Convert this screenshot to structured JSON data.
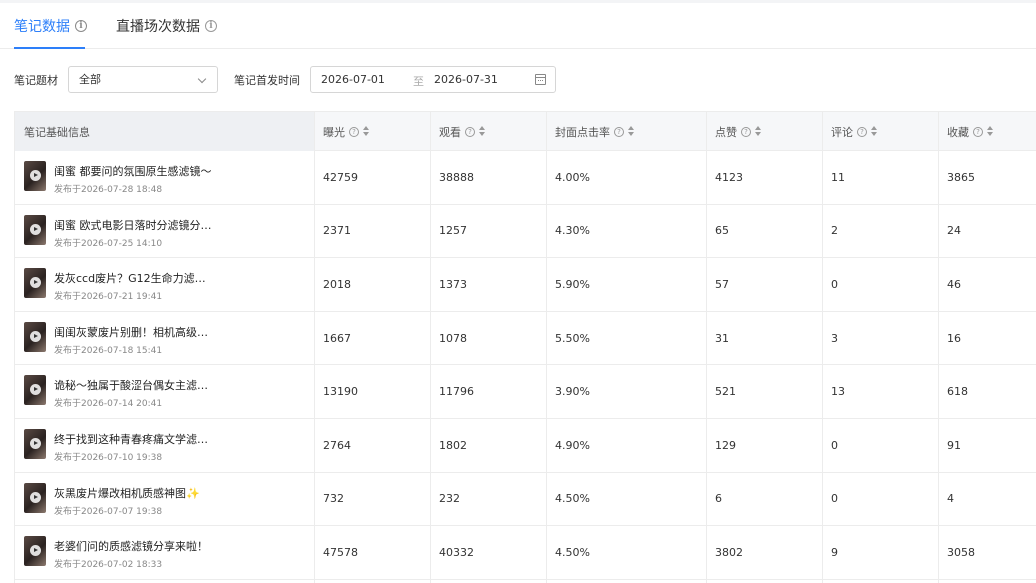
{
  "tabs": [
    {
      "label": "笔记数据",
      "active": true
    },
    {
      "label": "直播场次数据",
      "active": false
    }
  ],
  "colors": {
    "accent": "#2d7ff9",
    "header_bg": "#f6f7f9",
    "border": "#ececec"
  },
  "filters": {
    "topic_label": "笔记题材",
    "topic_value": "全部",
    "date_label": "笔记首发时间",
    "date_start": "2026-07-01",
    "date_sep": "至",
    "date_end": "2026-07-31"
  },
  "table": {
    "columns": [
      "笔记基础信息",
      "曝光",
      "观看",
      "封面点击率",
      "点赞",
      "评论",
      "收藏"
    ],
    "rows": [
      {
        "title": "闺蜜 都要问的氛围原生感滤镜～",
        "date": "发布于2026-07-28 18:48",
        "cells": [
          "42759",
          "38888",
          "4.00%",
          "4123",
          "11",
          "3865"
        ]
      },
      {
        "title": "闺蜜 欧式电影日落时分滤镜分…",
        "date": "发布于2026-07-25 14:10",
        "cells": [
          "2371",
          "1257",
          "4.30%",
          "65",
          "2",
          "24"
        ]
      },
      {
        "title": "发灰ccd废片？G12生命力滤…",
        "date": "发布于2026-07-21 19:41",
        "cells": [
          "2018",
          "1373",
          "5.90%",
          "57",
          "0",
          "46"
        ]
      },
      {
        "title": "闺闺灰蒙废片别删！相机高级…",
        "date": "发布于2026-07-18 15:41",
        "cells": [
          "1667",
          "1078",
          "5.50%",
          "31",
          "3",
          "16"
        ]
      },
      {
        "title": "诡秘～独属于酸涩台偶女主滤…",
        "date": "发布于2026-07-14 20:41",
        "cells": [
          "13190",
          "11796",
          "3.90%",
          "521",
          "13",
          "618"
        ]
      },
      {
        "title": "终于找到这种青春疼痛文学滤…",
        "date": "发布于2026-07-10 19:38",
        "cells": [
          "2764",
          "1802",
          "4.90%",
          "129",
          "0",
          "91"
        ]
      },
      {
        "title": "灰黑废片爆改相机质感神图✨",
        "date": "发布于2026-07-07 19:38",
        "cells": [
          "732",
          "232",
          "4.50%",
          "6",
          "0",
          "4"
        ]
      },
      {
        "title": "老婆们问的质感滤镜分享来啦！",
        "date": "发布于2026-07-02 18:33",
        "cells": [
          "47578",
          "40332",
          "4.50%",
          "3802",
          "9",
          "3058"
        ]
      }
    ]
  }
}
